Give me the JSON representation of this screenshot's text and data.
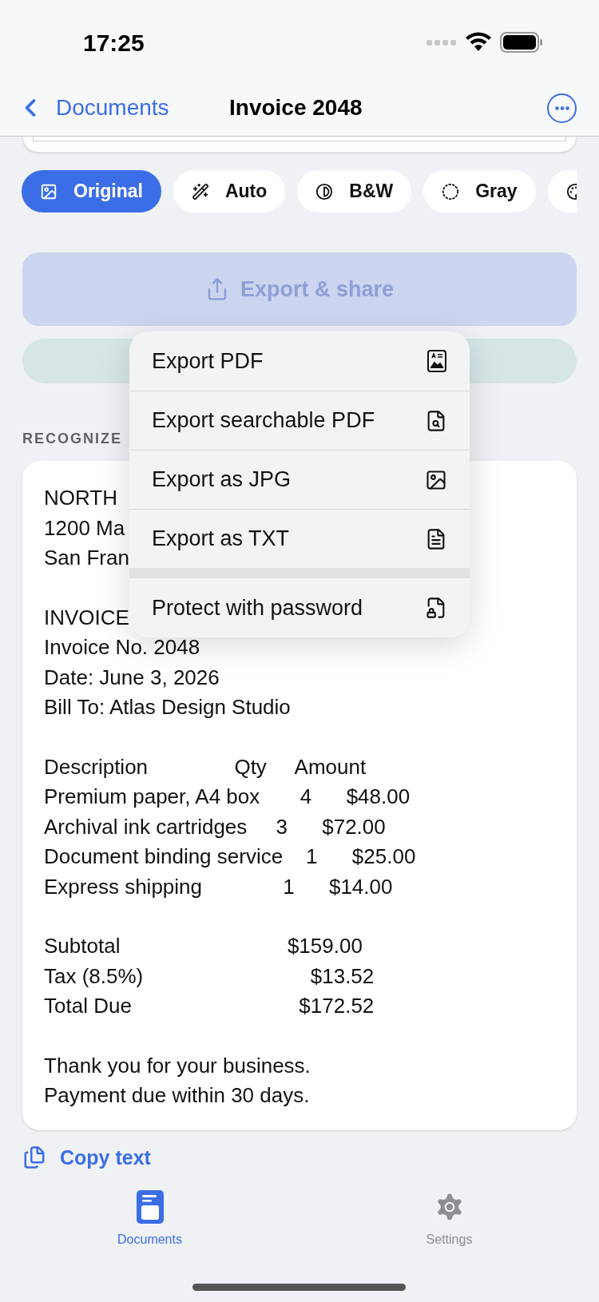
{
  "status_bar": {
    "time": "17:25"
  },
  "nav": {
    "back": "Documents",
    "title": "Invoice 2048"
  },
  "filters": [
    {
      "label": "Original",
      "kind": "image",
      "selected": true
    },
    {
      "label": "Auto",
      "kind": "wand",
      "selected": false
    },
    {
      "label": "B&W",
      "kind": "contrast",
      "selected": false
    },
    {
      "label": "Gray",
      "kind": "dotted",
      "selected": false
    },
    {
      "kind": "palette",
      "selected": false
    }
  ],
  "export_button": {
    "label": "Export & share"
  },
  "section_label": "RECOGNIZE",
  "recognized_text": [
    [
      "NORTH",
      "1200 Ma",
      "San Fran"
    ],
    [
      "INVOICE",
      "Invoice No. 2048",
      "Date: June 3, 2026",
      "Bill To: Atlas Design Studio"
    ],
    [
      "Description               Qty     Amount",
      "Premium paper, A4 box       4      $48.00",
      "Archival ink cartridges     3      $72.00",
      "Document binding service    1      $25.00",
      "Express shipping              1      $14.00"
    ],
    [
      "Subtotal                             $159.00",
      "Tax (8.5%)                             $13.52",
      "Total Due                             $172.52"
    ],
    [
      "Thank you for your business.",
      "Payment due within 30 days."
    ]
  ],
  "menu": [
    {
      "items": [
        {
          "label": "Export PDF",
          "kind": "pdf"
        },
        {
          "label": "Export searchable PDF",
          "kind": "search-doc"
        },
        {
          "label": "Export as JPG",
          "kind": "image"
        },
        {
          "label": "Export as TXT",
          "kind": "text-doc"
        }
      ]
    },
    {
      "items": [
        {
          "label": "Protect with password",
          "kind": "lock-doc"
        }
      ]
    }
  ],
  "copy_button": "Copy text",
  "tabs": [
    {
      "label": "Documents",
      "kind": "documents",
      "selected": true
    },
    {
      "label": "Settings",
      "kind": "settings",
      "selected": false
    }
  ]
}
